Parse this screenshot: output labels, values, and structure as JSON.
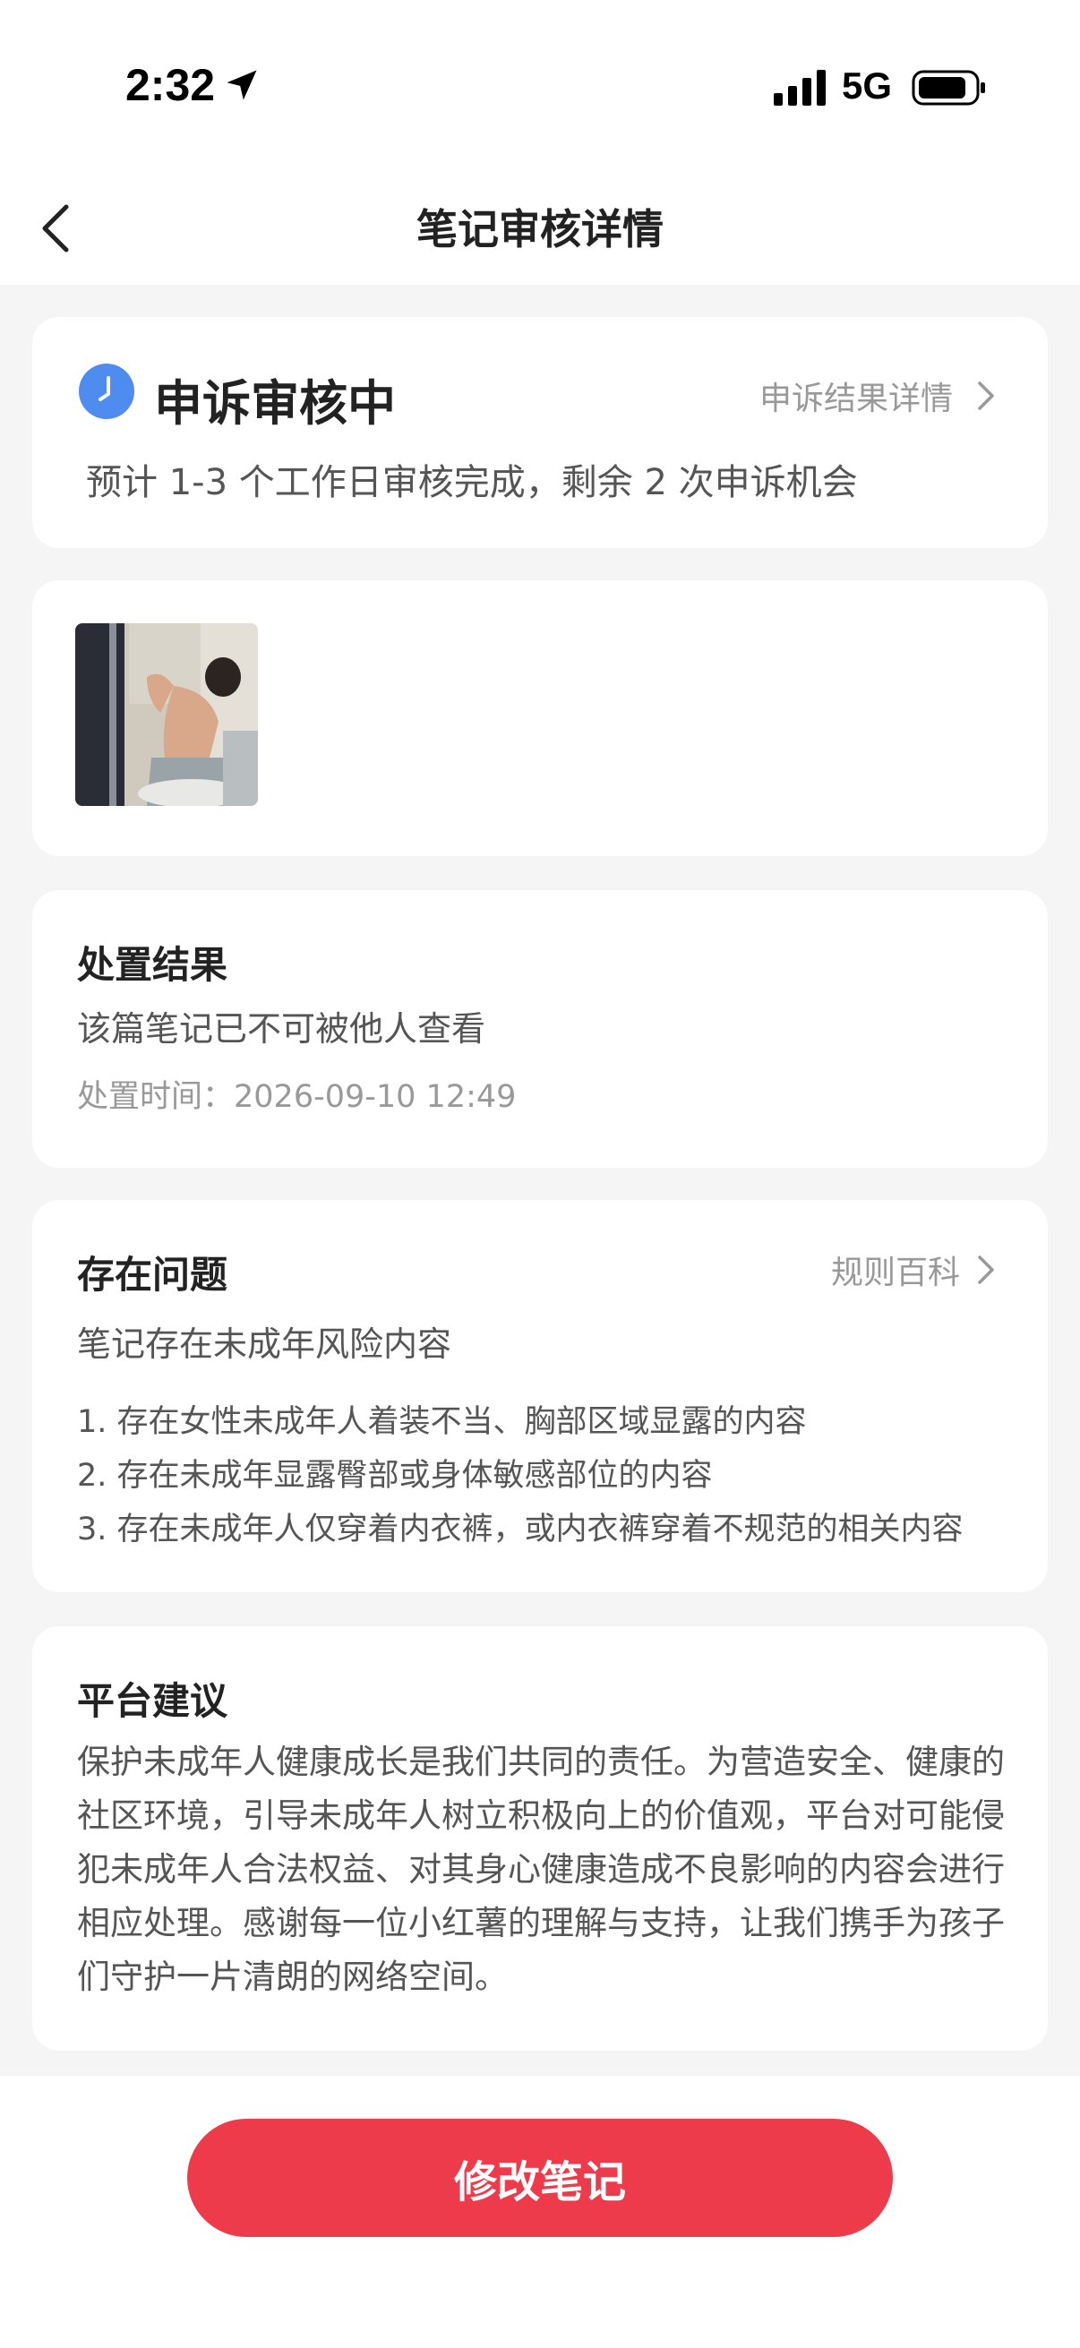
{
  "status_bar": {
    "time": "2:32",
    "network": "5G"
  },
  "nav": {
    "title": "笔记审核详情"
  },
  "appeal_status": {
    "title": "申诉审核中",
    "link_label": "申诉结果详情",
    "description": "预计 1-3 个工作日审核完成，剩余 2 次申诉机会"
  },
  "disposal": {
    "title": "处置结果",
    "result": "该篇笔记已不可被他人查看",
    "time_label": "处置时间：",
    "time_value": "2026-09-10 12:49"
  },
  "issues": {
    "title": "存在问题",
    "rules_link": "规则百科",
    "summary": "笔记存在未成年风险内容",
    "items": [
      "1.  存在女性未成年人着装不当、胸部区域显露的内容",
      "2. 存在未成年显露臀部或身体敏感部位的内容",
      "3. 存在未成年人仅穿着内衣裤，或内衣裤穿着不规范的相关内容"
    ]
  },
  "advice": {
    "title": "平台建议",
    "text": "保护未成年人健康成长是我们共同的责任。为营造安全、健康的社区环境，引导未成年人树立积极向上的价值观，平台对可能侵犯未成年人合法权益、对其身心健康造成不良影响的内容会进行相应处理。感谢每一位小红薯的理解与支持，让我们携手为孩子们守护一片清朗的网络空间。"
  },
  "bottom": {
    "edit_button": "修改笔记"
  },
  "colors": {
    "accent_red": "#ee3b4b",
    "status_blue": "#4e8cf0",
    "background": "#f5f5f5"
  }
}
